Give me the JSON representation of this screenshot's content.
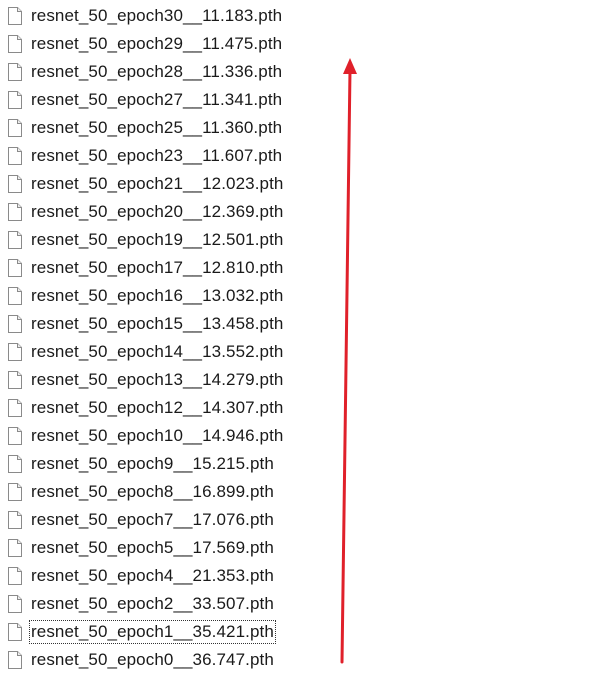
{
  "file_list": {
    "icon": "document-file-icon",
    "focused_index": 22,
    "files": [
      "resnet_50_epoch30__11.183.pth",
      "resnet_50_epoch29__11.475.pth",
      "resnet_50_epoch28__11.336.pth",
      "resnet_50_epoch27__11.341.pth",
      "resnet_50_epoch25__11.360.pth",
      "resnet_50_epoch23__11.607.pth",
      "resnet_50_epoch21__12.023.pth",
      "resnet_50_epoch20__12.369.pth",
      "resnet_50_epoch19__12.501.pth",
      "resnet_50_epoch17__12.810.pth",
      "resnet_50_epoch16__13.032.pth",
      "resnet_50_epoch15__13.458.pth",
      "resnet_50_epoch14__13.552.pth",
      "resnet_50_epoch13__14.279.pth",
      "resnet_50_epoch12__14.307.pth",
      "resnet_50_epoch10__14.946.pth",
      "resnet_50_epoch9__15.215.pth",
      "resnet_50_epoch8__16.899.pth",
      "resnet_50_epoch7__17.076.pth",
      "resnet_50_epoch5__17.569.pth",
      "resnet_50_epoch4__21.353.pth",
      "resnet_50_epoch2__33.507.pth",
      "resnet_50_epoch1__35.421.pth",
      "resnet_50_epoch0__36.747.pth"
    ]
  },
  "annotation": {
    "arrow_color": "#e0202a",
    "arrow_direction": "up"
  }
}
